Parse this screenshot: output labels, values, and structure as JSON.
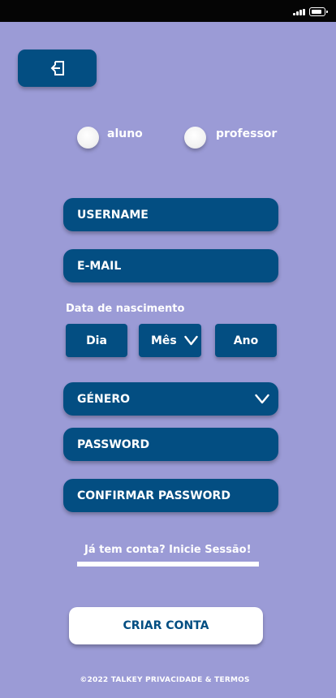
{
  "status_bar": {
    "signal_icon": "signal-bars-icon",
    "battery_icon": "battery-icon"
  },
  "back_button": {
    "icon": "exit-arrow-icon"
  },
  "user_type": {
    "options": [
      {
        "label": "aluno",
        "selected": false
      },
      {
        "label": "professor",
        "selected": false
      }
    ]
  },
  "form": {
    "username_label": "USERNAME",
    "email_label": "E-MAIL",
    "birthdate": {
      "label": "Data de nascimento",
      "day": "Dia",
      "month": "Mês",
      "year": "Ano"
    },
    "gender_label": "GÉNERO",
    "password_label": "PASSWORD",
    "confirm_password_label": "CONFIRMAR PASSWORD"
  },
  "login_link": "Já tem conta? Inicie Sessão!",
  "create_account_button": "CRIAR CONTA",
  "footer": "©2022 TALKEY PRIVACIDADE & TERMOS",
  "colors": {
    "background": "#9b9bd6",
    "primary": "#034e82",
    "text_light": "#ffffff",
    "status_bar": "#050505"
  }
}
